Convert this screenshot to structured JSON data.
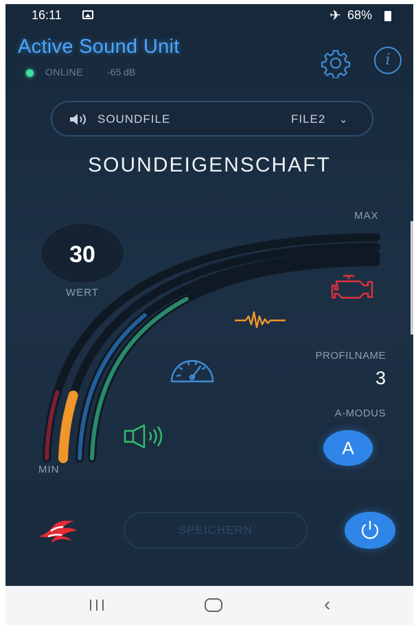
{
  "status_bar": {
    "time": "16:11",
    "battery": "68%",
    "icons": [
      "gallery-icon",
      "airplane-icon",
      "battery-icon"
    ]
  },
  "header": {
    "title": "Active Sound Unit",
    "connection_status": "ONLINE",
    "signal_level": "-65 dB",
    "icons": [
      "gear-icon",
      "info-icon"
    ]
  },
  "soundfile": {
    "label": "SOUNDFILE",
    "selected": "FILE2"
  },
  "section_title": "SOUNDEIGENSCHAFT",
  "gauge": {
    "max_label": "MAX",
    "min_label": "MIN",
    "value": "30",
    "value_caption": "WERT",
    "arcs": [
      {
        "name": "red-track",
        "color": "#7d1f34",
        "fill_fraction": 0.15
      },
      {
        "name": "orange-track",
        "color": "#f0962a",
        "fill_fraction": 0.15
      },
      {
        "name": "blue-track",
        "color": "#245f9a",
        "fill_fraction": 0.4
      },
      {
        "name": "green-track",
        "color": "#2a8a6c",
        "fill_fraction": 0.5
      }
    ],
    "icons": [
      "engine-icon",
      "sound-wave-icon",
      "speedometer-icon",
      "speaker-icon"
    ]
  },
  "profile": {
    "caption": "PROFILNAME",
    "value": "3"
  },
  "a_mode": {
    "caption": "A-MODUS",
    "button_label": "A"
  },
  "footer": {
    "save_label": "SPEICHERN",
    "icons": [
      "brand-logo-icon",
      "power-icon"
    ]
  },
  "colors": {
    "accent": "#2f86e8",
    "title_blue": "#4aa7ff",
    "online_green": "#3ee0a0",
    "engine_red": "#e0303c",
    "wave_orange": "#f0962a",
    "speedo_blue": "#3f8ed8",
    "speaker_green": "#32c06a"
  },
  "nav_bar": {
    "icons": [
      "recent-apps-icon",
      "home-icon",
      "back-icon"
    ]
  }
}
